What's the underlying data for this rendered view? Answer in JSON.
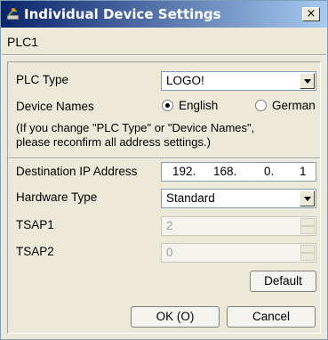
{
  "window": {
    "title": "Individual Device Settings",
    "close_label": "×"
  },
  "header": {
    "device_name": "PLC1"
  },
  "form": {
    "plc_type": {
      "label": "PLC Type",
      "value": "LOGO!"
    },
    "device_names": {
      "label": "Device Names",
      "options": [
        {
          "label": "English",
          "selected": true
        },
        {
          "label": "German",
          "selected": false
        }
      ]
    },
    "note": [
      "(If you change \"PLC Type\" or \"Device Names\",",
      "please reconfirm all address settings.)"
    ],
    "destination_ip": {
      "label": "Destination IP Address",
      "octets": [
        "192.",
        "168.",
        "0.",
        "1"
      ]
    },
    "hardware_type": {
      "label": "Hardware Type",
      "value": "Standard"
    },
    "tsap1": {
      "label": "TSAP1",
      "value": "2"
    },
    "tsap2": {
      "label": "TSAP2",
      "value": "0"
    },
    "default_label": "Default"
  },
  "footer": {
    "ok_label": "OK (O)",
    "cancel_label": "Cancel"
  }
}
